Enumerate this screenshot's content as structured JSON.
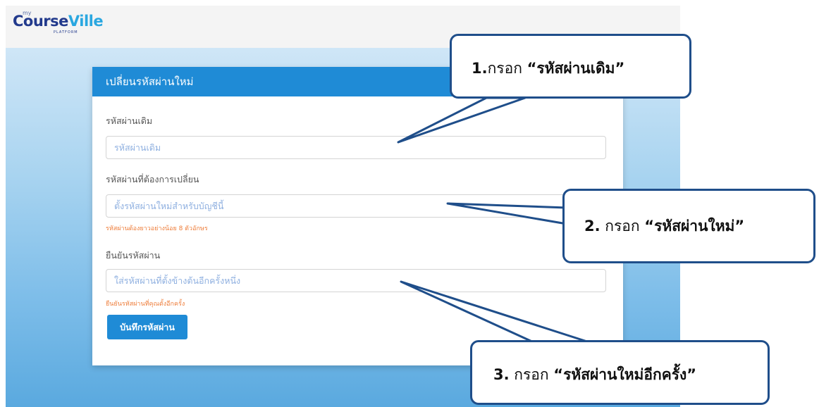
{
  "logo": {
    "prefix": "my",
    "course": "Course",
    "ville": "Ville",
    "sub": "PLATFORM"
  },
  "card": {
    "title": "เปลี่ยนรหัสผ่านใหม่"
  },
  "form": {
    "old_password": {
      "label": "รหัสผ่านเดิม",
      "placeholder": "รหัสผ่านเดิม"
    },
    "new_password": {
      "label": "รหัสผ่านที่ต้องการเปลี่ยน",
      "placeholder": "ตั้งรหัสผ่านใหม่สำหรับบัญชีนี้",
      "hint": "รหัสผ่านต้องยาวอย่างน้อย 8 ตัวอักษร"
    },
    "confirm_password": {
      "label": "ยืนยันรหัสผ่าน",
      "placeholder": "ใส่รหัสผ่านที่ตั้งข้างต้นอีกครั้งหนึ่ง",
      "hint": "ยืนยันรหัสผ่านที่คุณตั้งอีกครั้ง"
    },
    "save_label": "บันทึกรหัสผ่าน"
  },
  "callouts": [
    {
      "number": "1.",
      "text": "กรอก ",
      "emphasis": "“รหัสผ่านเดิม”"
    },
    {
      "number": "2.",
      "text": " กรอก ",
      "emphasis": "“รหัสผ่านใหม่”"
    },
    {
      "number": "3.",
      "text": " กรอก ",
      "emphasis": "“รหัสผ่านใหม่อีกครั้ง”"
    }
  ],
  "colors": {
    "primary": "#1f8bd6",
    "brand_dark": "#223a8c",
    "brand_light": "#2aa7e0",
    "hint": "#ee7d3a",
    "callout_border": "#1f4e8a"
  }
}
